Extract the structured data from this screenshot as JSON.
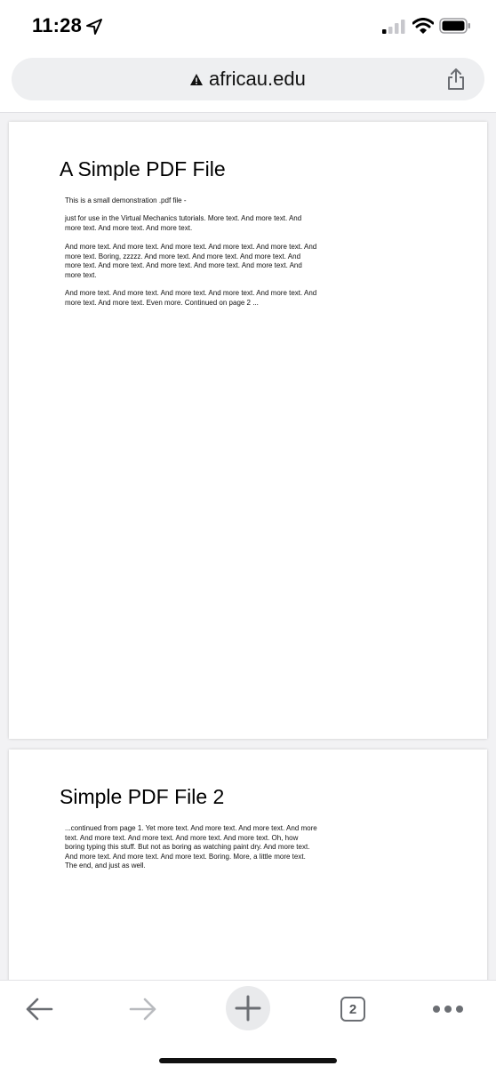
{
  "status_bar": {
    "time": "11:28"
  },
  "url_bar": {
    "host": "africau.edu"
  },
  "pages": [
    {
      "title": "A Simple PDF File",
      "paragraphs": [
        "This is a small demonstration .pdf file -",
        "just for use in the Virtual Mechanics tutorials. More text. And more text. And more text. And more text. And more text.",
        "And more text. And more text. And more text. And more text. And more text. And more text. Boring, zzzzz. And more text. And more text. And more text. And more text. And more text. And more text. And more text. And more text. And more text.",
        "And more text. And more text. And more text. And more text. And more text. And more text. And more text. Even more. Continued on page 2 ..."
      ]
    },
    {
      "title": "Simple PDF File 2",
      "paragraphs": [
        "...continued from page 1. Yet more text. And more text. And more text. And more text. And more text. And more text. And more text. And more text. Oh, how boring typing this stuff. But not as boring as watching paint dry. And more text. And more text. And more text. And more text. Boring.  More, a little more text. The end, and just as well."
      ]
    }
  ],
  "toolbar": {
    "tab_count": "2"
  },
  "icons": {
    "location": "location-arrow-icon",
    "signal": "cellular-signal-icon",
    "wifi": "wifi-icon",
    "battery": "battery-icon",
    "warning": "warning-triangle-icon",
    "share": "share-icon",
    "back": "back-arrow-icon",
    "forward": "forward-arrow-icon",
    "new_tab": "plus-icon",
    "tabs": "tab-switcher-icon",
    "more": "more-dots-icon"
  }
}
